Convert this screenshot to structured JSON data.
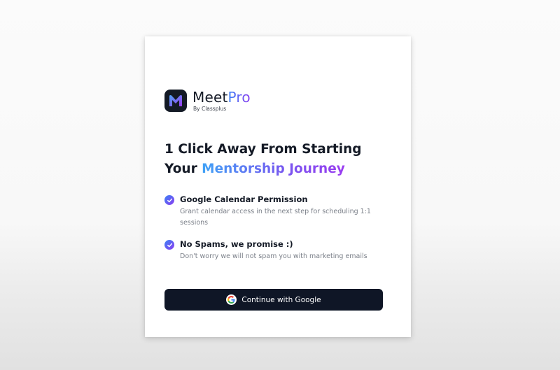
{
  "logo": {
    "brand_main": "Meet",
    "brand_accent": "Pro",
    "byline": "By Classplus"
  },
  "headline": {
    "line1": "1 Click Away From Starting",
    "line2_plain": "Your ",
    "line2_gradient": "Mentorship Journey"
  },
  "features": [
    {
      "icon": "check-circle-icon",
      "title": "Google Calendar Permission",
      "description": "Grant calendar access in the next step for scheduling 1:1 sessions"
    },
    {
      "icon": "check-circle-icon",
      "title": "No Spams, we promise :)",
      "description": "Don't worry we will not spam you with marketing emails"
    }
  ],
  "google_button": {
    "icon": "google-icon",
    "label": "Continue with Google"
  },
  "colors": {
    "primary_dark": "#141a26",
    "gradient_start": "#3b82f6",
    "gradient_end": "#8b3cf0",
    "button_bg": "#0f1626",
    "muted_text": "#7a7f88"
  }
}
